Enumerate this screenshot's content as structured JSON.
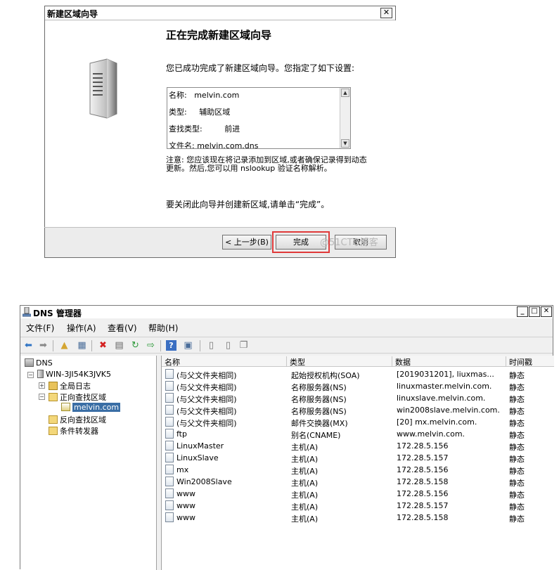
{
  "wizard": {
    "title": "新建区域向导",
    "heading": "正在完成新建区域向导",
    "intro": "您已成功完成了新建区域向导。您指定了如下设置:",
    "summary": [
      {
        "label": "名称:",
        "value": "melvin.com"
      },
      {
        "label": "类型:",
        "value": "辅助区域"
      },
      {
        "label": "查找类型:",
        "value": "前进"
      },
      {
        "label": "文件名:",
        "value": "melvin.com.dns"
      }
    ],
    "note": "注意: 您应该现在将记录添加到区域,或者确保记录得到动态更新。然后,您可以用 nslookup 验证名称解析。",
    "close_text": "要关闭此向导并创建新区域,请单击“完成”。",
    "buttons": {
      "back": "< 上一步(B)",
      "finish": "完成",
      "cancel": "取消"
    },
    "watermark": "@51CTO博客"
  },
  "dns": {
    "title": "DNS 管理器",
    "menu": [
      "文件(F)",
      "操作(A)",
      "查看(V)",
      "帮助(H)"
    ],
    "tree": {
      "root": "DNS",
      "server": "WIN-3JI54K3JVK5",
      "global_log": "全局日志",
      "forward_zones": "正向查找区域",
      "selected_zone": "melvin.com",
      "reverse_zones": "反向查找区域",
      "conditional_forwarders": "条件转发器"
    },
    "columns": [
      "名称",
      "类型",
      "数据",
      "时间戳"
    ],
    "records": [
      {
        "name": "(与父文件夹相同)",
        "type": "起始授权机构(SOA)",
        "data": "[2019031201], liuxmas...",
        "ts": "静态"
      },
      {
        "name": "(与父文件夹相同)",
        "type": "名称服务器(NS)",
        "data": "linuxmaster.melvin.com.",
        "ts": "静态"
      },
      {
        "name": "(与父文件夹相同)",
        "type": "名称服务器(NS)",
        "data": "linuxslave.melvin.com.",
        "ts": "静态"
      },
      {
        "name": "(与父文件夹相同)",
        "type": "名称服务器(NS)",
        "data": "win2008slave.melvin.com.",
        "ts": "静态"
      },
      {
        "name": "(与父文件夹相同)",
        "type": "邮件交换器(MX)",
        "data": "[20]  mx.melvin.com.",
        "ts": "静态"
      },
      {
        "name": "ftp",
        "type": "别名(CNAME)",
        "data": "www.melvin.com.",
        "ts": "静态"
      },
      {
        "name": "LinuxMaster",
        "type": "主机(A)",
        "data": "172.28.5.156",
        "ts": "静态"
      },
      {
        "name": "LinuxSlave",
        "type": "主机(A)",
        "data": "172.28.5.157",
        "ts": "静态"
      },
      {
        "name": "mx",
        "type": "主机(A)",
        "data": "172.28.5.156",
        "ts": "静态"
      },
      {
        "name": "Win2008Slave",
        "type": "主机(A)",
        "data": "172.28.5.158",
        "ts": "静态"
      },
      {
        "name": "www",
        "type": "主机(A)",
        "data": "172.28.5.156",
        "ts": "静态"
      },
      {
        "name": "www",
        "type": "主机(A)",
        "data": "172.28.5.157",
        "ts": "静态"
      },
      {
        "name": "www",
        "type": "主机(A)",
        "data": "172.28.5.158",
        "ts": "静态"
      }
    ]
  },
  "colors": {
    "highlight": "#e03a3a",
    "selection": "#3a6ea5",
    "folder": "#e8c25a"
  }
}
